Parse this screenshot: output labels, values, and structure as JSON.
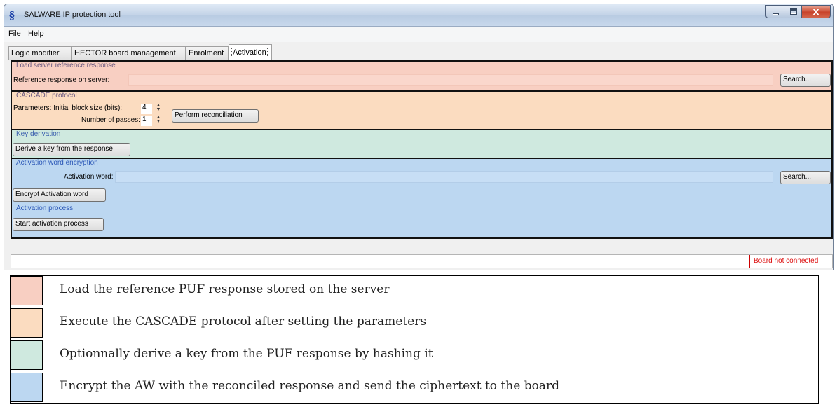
{
  "window": {
    "title": "SALWARE IP protection tool",
    "app_icon_glyph": "§",
    "close_glyph": "x"
  },
  "menu": {
    "file": "File",
    "help": "Help"
  },
  "tabs": [
    "Logic modifier",
    "HECTOR board management",
    "Enrolment",
    "Activation"
  ],
  "active_tab": "Activation",
  "load_section": {
    "title": "Load server reference response",
    "field_label": "Reference response on server:",
    "field_value": "",
    "search_button": "Search..."
  },
  "cascade_section": {
    "title": "CASCADE protocol",
    "params_label": "Parameters: Initial block size (bits):",
    "block_size": "4",
    "passes_label": "Number of passes:",
    "passes": "1",
    "perform_button": "Perform reconciliation"
  },
  "key_section": {
    "title": "Key derivation",
    "derive_button": "Derive a key from the response"
  },
  "aw_section": {
    "title": "Activation word encryption",
    "field_label": "Activation word:",
    "field_value": "",
    "search_button": "Search...",
    "encrypt_button": "Encrypt Activation word"
  },
  "process_section": {
    "title": "Activation process",
    "start_button": "Start activation process"
  },
  "status": {
    "board": "Board not connected"
  },
  "colors": {
    "load": "#f8cfc2",
    "cascade": "#fbdcc0",
    "key": "#cfe9df",
    "activation": "#bcd7f1",
    "status_red": "#dd1111"
  },
  "legend": [
    {
      "color": "#f8cfc2",
      "text": "Load the reference PUF response stored on the server"
    },
    {
      "color": "#fbdcc0",
      "text": "Execute the CASCADE protocol after setting the parameters"
    },
    {
      "color": "#cfe9df",
      "text": "Optionnally derive a key from the PUF response by hashing it"
    },
    {
      "color": "#bcd7f1",
      "text": "Encrypt the AW with the reconciled response and send the ciphertext to the board"
    }
  ]
}
